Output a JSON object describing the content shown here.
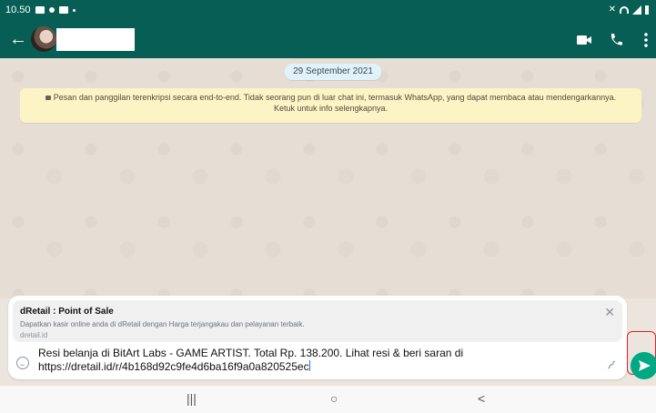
{
  "status_bar": {
    "time": "10.50",
    "icons": [
      "gallery-icon",
      "nfc-icon",
      "notification-icon",
      "dot-icon",
      "mute-icon",
      "wifi-icon",
      "signal-icon",
      "battery-icon"
    ]
  },
  "app_bar": {
    "back_icon": "arrow-left-icon",
    "contact_name": "",
    "icons": [
      "video-call-icon",
      "voice-call-icon",
      "more-vert-icon"
    ]
  },
  "chat": {
    "date_label": "29 September 2021",
    "encryption_notice_line1": "Pesan dan panggilan terenkripsi secara end-to-end. Tidak seorang pun di luar chat ini, termasuk WhatsApp, yang dapat membaca atau mendengarkannya.",
    "encryption_notice_line2": "Ketuk untuk info selengkapnya."
  },
  "composer": {
    "preview": {
      "title": "dRetail : Point of Sale",
      "description": "Dapatkan kasir online anda di dRetail dengan Harga terjangakau dan pelayanan terbaik.",
      "domain": "dretail.id"
    },
    "message_line1": "Resi belanja di BitArt Labs - GAME ARTIST. Total Rp. 138.200. Lihat resi & beri saran di",
    "message_line2": "https://dretail.id/r/4b168d92c9fe4d6ba16f9a0a820525ec",
    "icons": [
      "emoji-icon",
      "attach-icon",
      "send-icon",
      "close-icon"
    ]
  },
  "nav_bar": {
    "recents": "|||",
    "home": "○",
    "back": "<"
  },
  "colors": {
    "header": "#075e54",
    "send_button": "#00a884",
    "highlight_box": "#e0222a",
    "encryption_notice_bg": "#fdf4c5"
  }
}
